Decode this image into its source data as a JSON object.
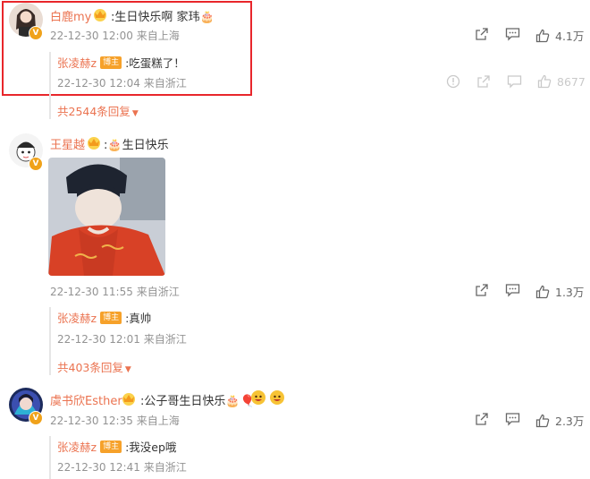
{
  "comments": [
    {
      "user": "白鹿my",
      "text": ":生日快乐啊 家玮🎂",
      "time": "22-12-30 12:00",
      "location": "来自上海",
      "likes": "4.1万",
      "reply": {
        "user": "张凌赫z",
        "badge": "博主",
        "text": ":吃蛋糕了！",
        "time": "22-12-30 12:04",
        "location": "来自浙江",
        "likes": "8677"
      },
      "more": "共2544条回复"
    },
    {
      "user": "王星越",
      "text": ":🎂生日快乐",
      "time": "22-12-30 11:55",
      "location": "来自浙江",
      "likes": "1.3万",
      "reply": {
        "user": "张凌赫z",
        "badge": "博主",
        "text": ":真帅",
        "time": "22-12-30 12:01",
        "location": "来自浙江"
      },
      "more": "共403条回复"
    },
    {
      "user": "虞书欣Esther",
      "text": ":公子哥生日快乐🎂🎈",
      "time": "22-12-30 12:35",
      "location": "来自上海",
      "likes": "2.3万",
      "reply": {
        "user": "张凌赫z",
        "badge": "博主",
        "text": ":我没ep哦",
        "time": "22-12-30 12:41",
        "location": "来自浙江"
      }
    }
  ],
  "vip_badge": "V",
  "colors": {
    "name": "#eb7350",
    "highlight": "#e8262b",
    "meta": "#939393"
  },
  "icons": [
    "share-icon",
    "comment-icon",
    "like-icon",
    "report-icon",
    "crown-icon"
  ]
}
